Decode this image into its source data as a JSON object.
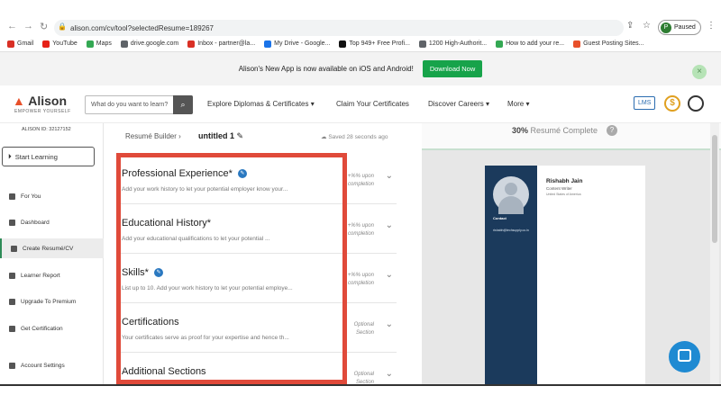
{
  "browser": {
    "url": "alison.com/cv/tool?selectedResume=189267",
    "profile_label": "Paused",
    "profile_initial": "P",
    "bookmarks": [
      "Gmail",
      "YouTube",
      "Maps",
      "drive.google.com",
      "Inbox - partner@la...",
      "My Drive - Google...",
      "Top 949+ Free Profi...",
      "1200 High-Authorit...",
      "How to add your re...",
      "Guest Posting Sites..."
    ]
  },
  "banner": {
    "text": "Alison's New App is now available on iOS and Android!",
    "download_label": "Download Now"
  },
  "header": {
    "logo": "Alison",
    "tagline": "EMPOWER YOURSELF",
    "search_placeholder": "What do you want to learn?",
    "nav": [
      "Explore Diplomas & Certificates",
      "Claim Your Certificates",
      "Discover Careers",
      "More"
    ],
    "lms_label": "LMS",
    "coin_symbol": "$"
  },
  "sidebar": {
    "alison_id": "ALISON ID: 32127152",
    "start_label": "Start Learning",
    "items": [
      "For You",
      "Dashboard",
      "Create Resumé/CV",
      "Learner Report",
      "Upgrade To Premium",
      "Get Certification",
      "Account Settings"
    ]
  },
  "builder": {
    "crumb": "Resumé Builder",
    "title": "untitled 1",
    "saved": "Saved 28 seconds ago",
    "sections": [
      {
        "title": "Professional Experience*",
        "desc": "Add your work history to let your potential employer know your...",
        "side": "+%% upon completion",
        "edit": true
      },
      {
        "title": "Educational History*",
        "desc": "Add your educational qualifications to let your potential ...",
        "side": "+%% upon completion",
        "edit": false
      },
      {
        "title": "Skills*",
        "desc": "List up to 10. Add your work history to let your potential employe...",
        "side": "+%% upon completion",
        "edit": true
      },
      {
        "title": "Certifications",
        "desc": "Your certificates serve as proof for your expertise and hence th...",
        "side": "Optional Section",
        "edit": false
      },
      {
        "title": "Additional Sections",
        "desc": "",
        "side": "Optional Section",
        "edit": false
      }
    ]
  },
  "preview": {
    "percent": "30%",
    "complete_label": "Resumé Complete",
    "name": "Rishabh Jain",
    "role": "Content Writer",
    "location": "United States of America",
    "contact_label": "Contact",
    "email": "rishabh@techsupply.co.in"
  }
}
